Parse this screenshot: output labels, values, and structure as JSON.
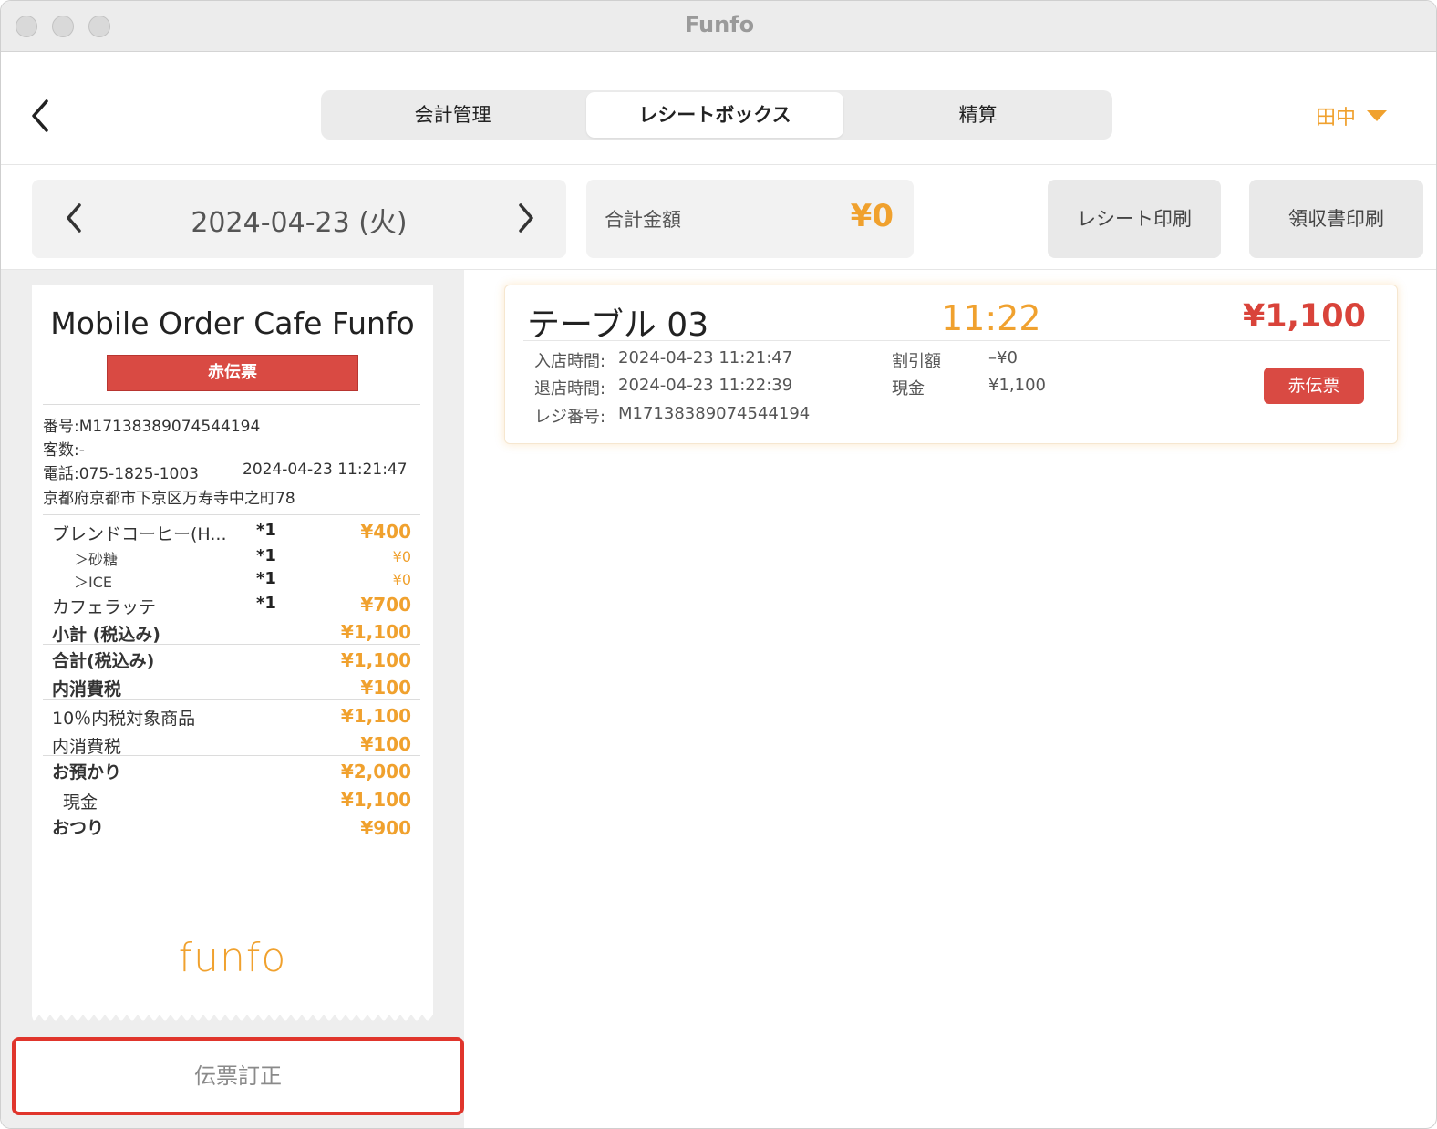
{
  "window": {
    "title": "Funfo"
  },
  "header": {
    "tabs": [
      {
        "label": "会計管理"
      },
      {
        "label": "レシートボックス"
      },
      {
        "label": "精算"
      }
    ],
    "user": "田中"
  },
  "toolbar": {
    "date": "2024-04-23 (火)",
    "total_label": "合計金額",
    "total_value": "¥0",
    "receipt_print": "レシート印刷",
    "invoice_print": "領収書印刷"
  },
  "receipt": {
    "store": "Mobile Order Cafe Funfo",
    "badge": "赤伝票",
    "number": "番号:M17138389074544194",
    "guests": "客数:-",
    "phone": "電話:075-1825-1003",
    "datetime": "2024-04-23 11:21:47",
    "address": "京都府京都市下京区万寿寺中之町78",
    "items": [
      {
        "name": "ブレンドコーヒー(H...",
        "qty": "*1",
        "price": "¥400"
      },
      {
        "name": "＞砂糖",
        "qty": "*1",
        "price": "¥0"
      },
      {
        "name": "＞ICE",
        "qty": "*1",
        "price": "¥0"
      },
      {
        "name": "カフェラッテ",
        "qty": "*1",
        "price": "¥700"
      }
    ],
    "subtotal_label": "小計 (税込み)",
    "subtotal": "¥1,100",
    "total_label": "合計(税込み)",
    "total": "¥1,100",
    "tax_label": "内消費税",
    "tax": "¥100",
    "taxable_label": "10％内税対象商品",
    "taxable": "¥1,100",
    "tax2_label": "内消費税",
    "tax2": "¥100",
    "deposit_label": "お預かり",
    "deposit": "¥2,000",
    "cash_label": "現金",
    "cash": "¥1,100",
    "change_label": "おつり",
    "change": "¥900",
    "logo": "funfo"
  },
  "fix_button": "伝票訂正",
  "card": {
    "table": "テーブル 03",
    "time": "11:22",
    "amount": "¥1,100",
    "in_label": "入店時間:",
    "in_value": "2024-04-23 11:21:47",
    "out_label": "退店時間:",
    "out_value": "2024-04-23 11:22:39",
    "reg_label": "レジ番号:",
    "reg_value": "M17138389074544194",
    "discount_label": "割引額",
    "discount_value": "–¥0",
    "cash_label": "現金",
    "cash_value": "¥1,100",
    "badge": "赤伝票"
  },
  "colors": {
    "accent": "#f0a12e",
    "red": "#d94a43",
    "highlight": "#e0352c"
  }
}
